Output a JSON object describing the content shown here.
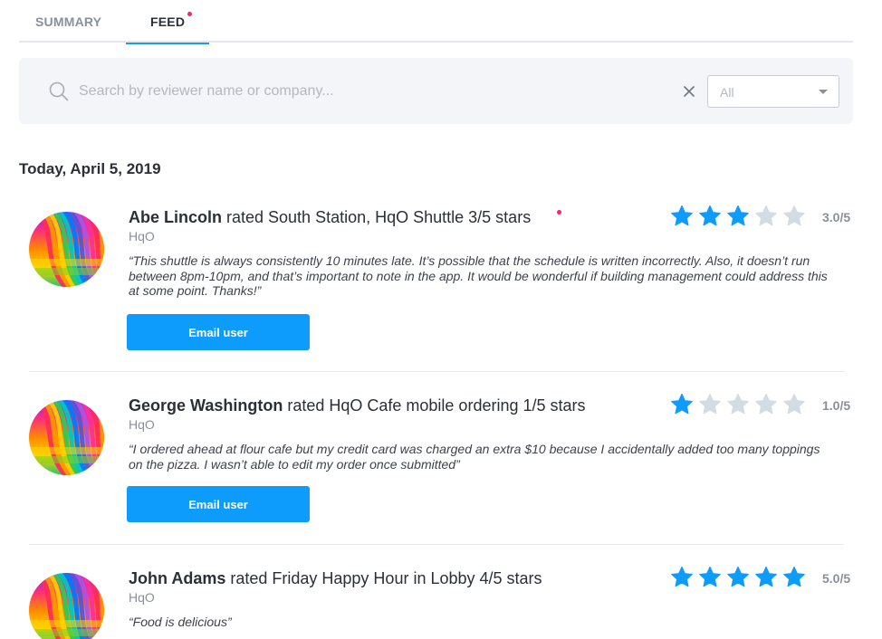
{
  "tabs": [
    {
      "label": "SUMMARY",
      "active": false
    },
    {
      "label": "FEED",
      "active": true,
      "has_notification": true
    }
  ],
  "search": {
    "placeholder": "Search by reviewer name or company...",
    "value": "",
    "filter_value": "All"
  },
  "date_heading": "Today, April 5, 2019",
  "colors": {
    "accent": "#0e9cfc",
    "star_filled": "#0e9cfc",
    "star_empty": "#d5dbe2",
    "notification": "#ff1e78"
  },
  "reviews": [
    {
      "name": "Abe Lincoln",
      "action": " rated South Station, HqO Shuttle 3/5 stars",
      "company": "HqO",
      "comment": "“This shuttle is always consistently 10 minutes late. It’s possible that the schedule is written incorrectly. Also, it doesn’t run between 8pm-10pm, and that’s important to note in the app. It would be wonderful if building management could address this at some point. Thanks!”",
      "rating": 3,
      "score_label": "3.0/5",
      "button_label": "Email user",
      "unread": true
    },
    {
      "name": "George Washington",
      "action": " rated HqO Cafe mobile ordering 1/5 stars",
      "company": "HqO",
      "comment": "“I ordered ahead at flour cafe but my credit card was charged an extra $10 because I accidentally added too many toppings on the pizza. I wasn’t able to edit my order once submitted”",
      "rating": 1,
      "score_label": "1.0/5",
      "button_label": "Email user",
      "unread": false
    },
    {
      "name": "John Adams",
      "action": " rated Friday Happy Hour in Lobby 4/5 stars",
      "company": "HqO",
      "comment": "“Food is delicious”",
      "rating": 5,
      "score_label": "5.0/5",
      "unread": false
    }
  ]
}
